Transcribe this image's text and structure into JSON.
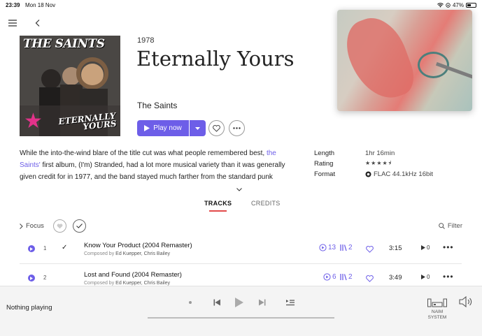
{
  "status_bar": {
    "time": "23:39",
    "date": "Mon 18 Nov",
    "battery": "47%",
    "battery_level": 0.47
  },
  "album": {
    "year": "1978",
    "title": "Eternally Yours",
    "artist": "The Saints",
    "cover_text_top": "THE SAINTS",
    "cover_text_bottom_1": "ETERNALLY",
    "cover_text_bottom_2": "YOURS"
  },
  "actions": {
    "play_label": "Play now"
  },
  "review": {
    "part1": "While the into-the-wind blare of the title cut was what people remembered best, ",
    "link": "the Saints'",
    "part2": " first album, (I'm) Stranded, had a lot more musical variety than it was generally given credit for in 1977, and the band stayed much farther from the standard punk"
  },
  "meta": {
    "length_label": "Length",
    "length_value": "1hr 16min",
    "rating_label": "Rating",
    "rating_value": 4.5,
    "rating_stars": "★★★★⯨",
    "format_label": "Format",
    "format_value": "FLAC 44.1kHz 16bit"
  },
  "tabs": {
    "tracks": "TRACKS",
    "credits": "CREDITS"
  },
  "focus": {
    "label": "Focus",
    "filter": "Filter"
  },
  "tracks": [
    {
      "num": "1",
      "title": "Know Your Product (2004 Remaster)",
      "composed_label": "Composed by",
      "composers": "Ed Kuepper, Chris Bailey",
      "radio": "13",
      "versions": "2",
      "duration": "3:15",
      "plays": "0"
    },
    {
      "num": "2",
      "title": "Lost and Found (2004 Remaster)",
      "composed_label": "Composed by",
      "composers": "Ed Kuepper, Chris Bailey",
      "radio": "6",
      "versions": "2",
      "duration": "3:49",
      "plays": "0"
    }
  ],
  "player": {
    "status": "Nothing playing",
    "device_line1": "NAIM",
    "device_line2": "SYSTEM"
  },
  "colors": {
    "accent": "#6d5ee8",
    "tab_underline": "#e24a4a"
  }
}
